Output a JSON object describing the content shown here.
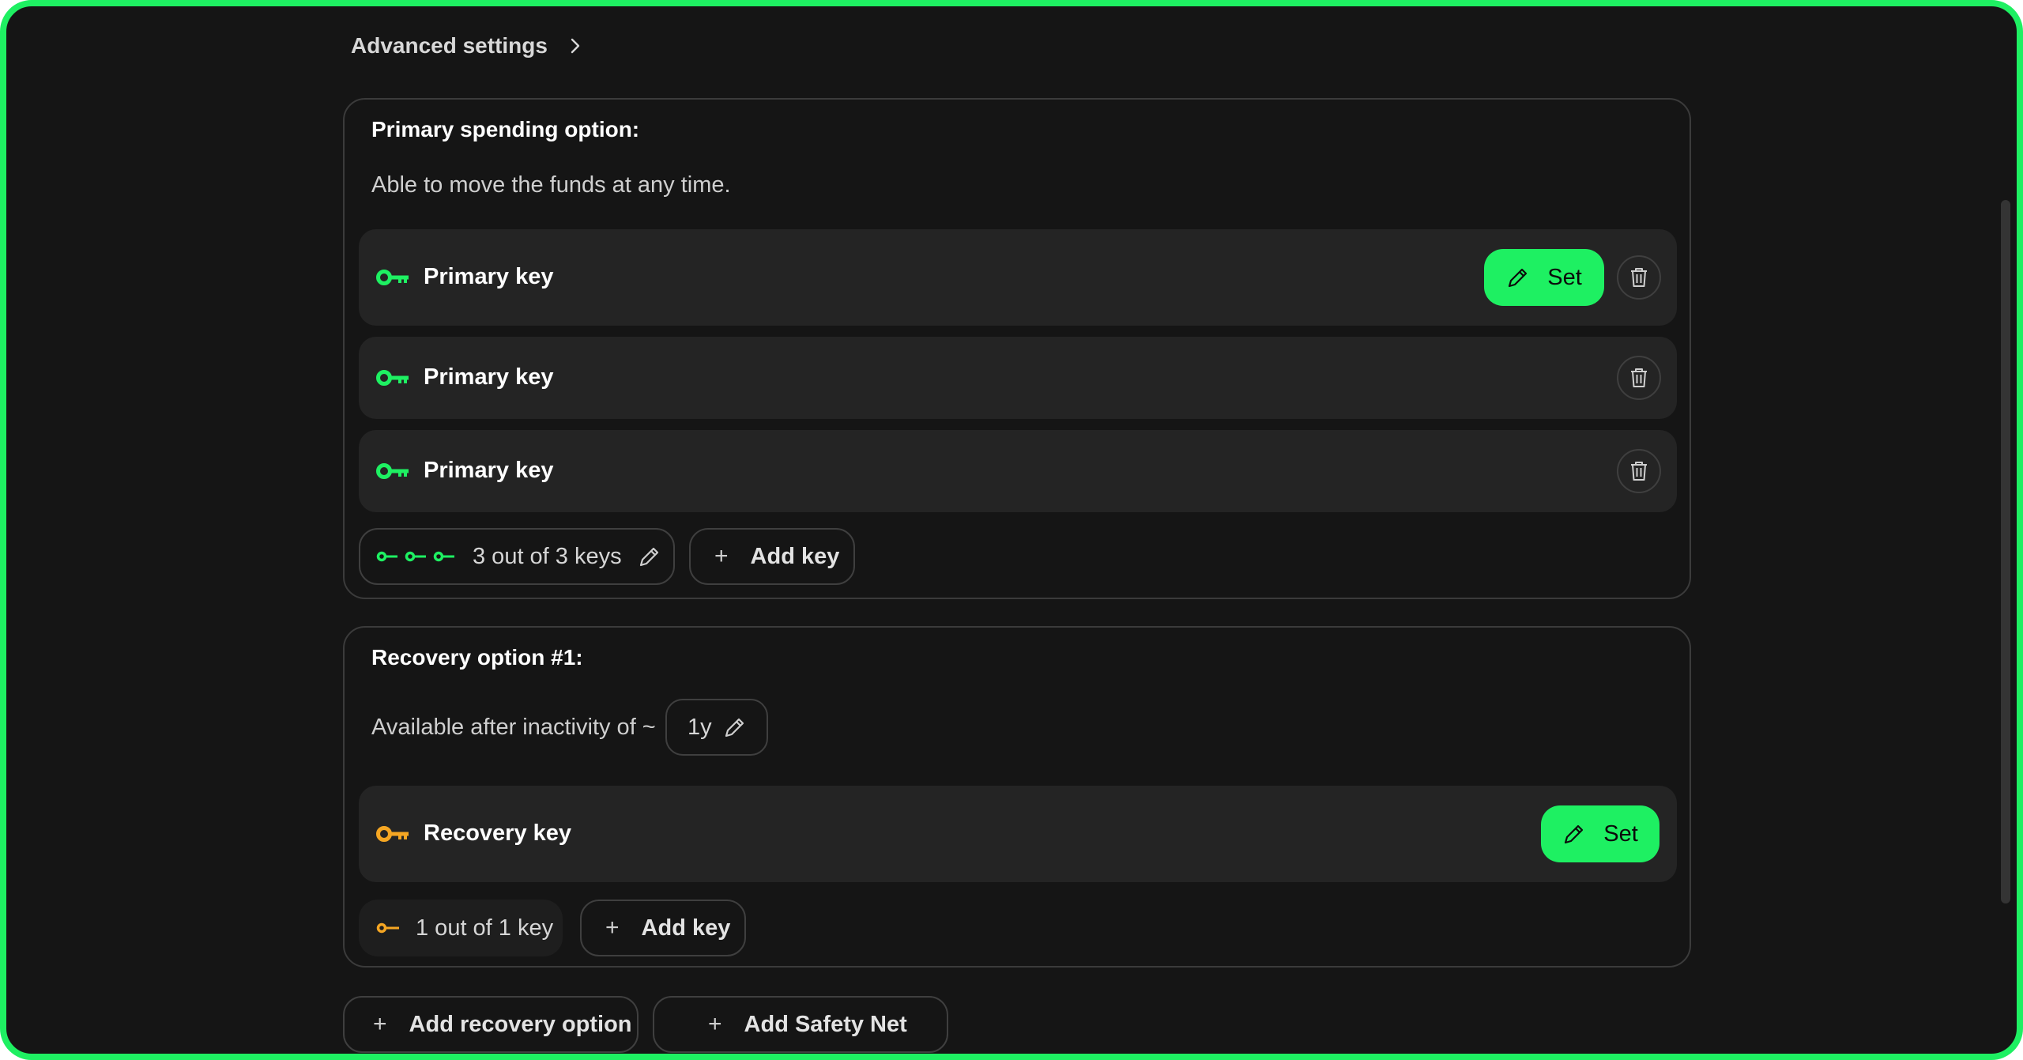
{
  "header": {
    "advanced_settings_label": "Advanced settings"
  },
  "colors": {
    "accent_green": "#1ef062",
    "recovery_orange": "#f5a623",
    "background": "#151515",
    "row_bg": "#242424"
  },
  "icons": {
    "chevron": "chevron-right-icon",
    "key": "key-icon",
    "pencil": "pencil-icon",
    "trash": "trash-icon",
    "plus": "plus-icon"
  },
  "primary": {
    "title": "Primary spending option:",
    "description": "Able to move the funds at any time.",
    "keys": [
      {
        "label": "Primary key",
        "set_label": "Set"
      },
      {
        "label": "Primary key"
      },
      {
        "label": "Primary key"
      }
    ],
    "threshold_label": "3 out of 3 keys",
    "add_key_label": "Add key"
  },
  "recovery": {
    "title": "Recovery option #1:",
    "description": "Available after inactivity of ~",
    "inactivity_value": "1y",
    "keys": [
      {
        "label": "Recovery key",
        "set_label": "Set"
      }
    ],
    "threshold_label": "1 out of 1 key",
    "add_key_label": "Add key"
  },
  "footer": {
    "add_recovery_label": "Add recovery option",
    "add_safety_net_label": "Add Safety Net"
  }
}
